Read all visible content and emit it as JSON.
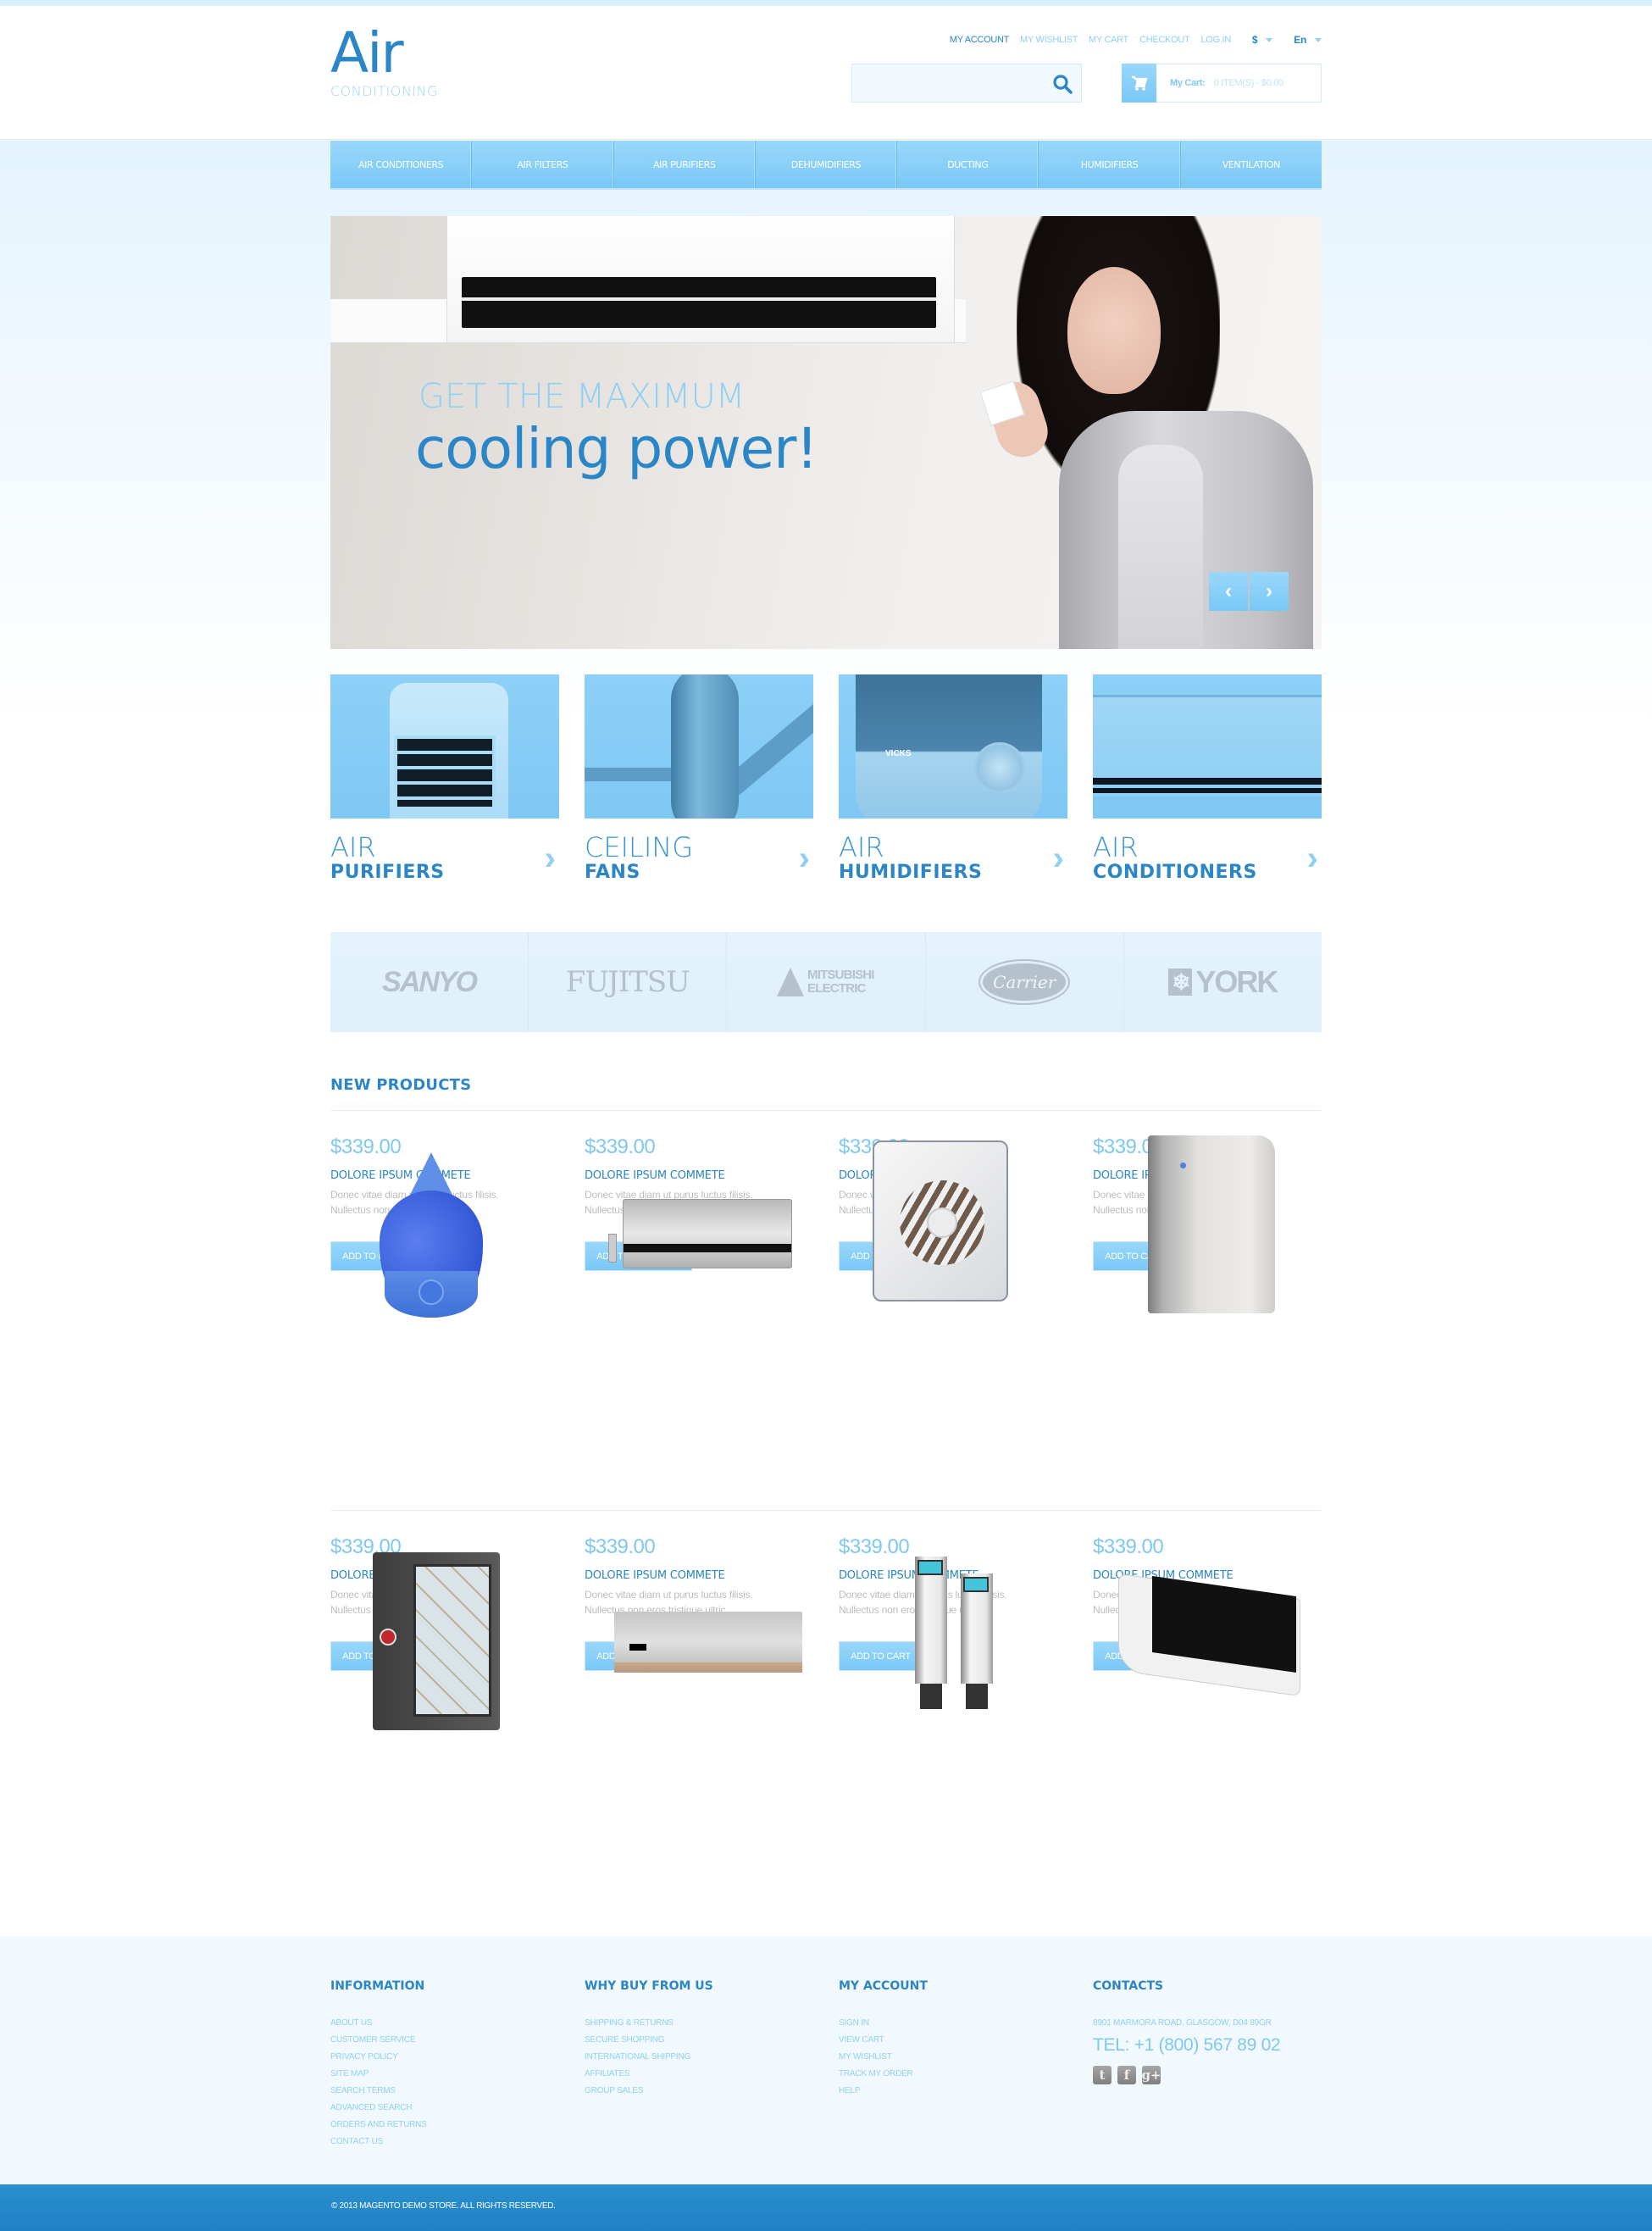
{
  "logo": {
    "main": "Air",
    "sub": "CONDITIONING"
  },
  "top_links": [
    {
      "label": "MY ACCOUNT",
      "active": true
    },
    {
      "label": "MY WISHLIST",
      "active": false
    },
    {
      "label": "MY CART",
      "active": false
    },
    {
      "label": "CHECKOUT",
      "active": false
    },
    {
      "label": "LOG IN",
      "active": false
    }
  ],
  "currency": {
    "selected": "$"
  },
  "language": {
    "selected": "En"
  },
  "search": {
    "placeholder": "",
    "value": ""
  },
  "cart": {
    "label": "My Cart:",
    "summary": "0 ITEM(S) - $0.00"
  },
  "nav": [
    "AIR CONDITIONERS",
    "AIR FILTERS",
    "AIR PURIFIERS",
    "DEHUMIDIFIERS",
    "DUCTING",
    "HUMIDIFIERS",
    "VENTILATION"
  ],
  "hero": {
    "line1": "GET THE MAXIMUM",
    "line2": "cooling power!",
    "prev_icon": "chevron-left-icon",
    "next_icon": "chevron-right-icon"
  },
  "categories": [
    {
      "line1": "AIR",
      "line2": "PURIFIERS"
    },
    {
      "line1": "CEILING",
      "line2": "FANS"
    },
    {
      "line1": "AIR",
      "line2": "HUMIDIFIERS"
    },
    {
      "line1": "AIR",
      "line2": "CONDITIONERS"
    }
  ],
  "brands": [
    "SANYO",
    "FUJITSU",
    "MITSUBISHI ELECTRIC",
    "Carrier",
    "YORK"
  ],
  "new_products": {
    "title": "NEW PRODUCTS",
    "add_to_cart": "ADD TO CART",
    "items": [
      {
        "price": "$339.00",
        "name": "DOLORE IPSUM COMMETE",
        "desc1": "Donec vitae diam ut purus luctus filisis.",
        "desc2": "Nullectus non eros tristique ultric.",
        "image": "drop-humidifier"
      },
      {
        "price": "$339.00",
        "name": "DOLORE IPSUM COMMETE",
        "desc1": "Donec vitae diam ut purus luctus filisis.",
        "desc2": "Nullectus non eros tristique ultric.",
        "image": "split-air-conditioner"
      },
      {
        "price": "$339.00",
        "name": "DOLORE IPSUM COMMETE",
        "desc1": "Donec vitae diam ut purus luctus filisis.",
        "desc2": "Nullectus non eros tristique ultric.",
        "image": "ventilation-fan"
      },
      {
        "price": "$339.00",
        "name": "DOLORE IPSUM COMMETE",
        "desc1": "Donec vitae diam ut purus luctus filisis.",
        "desc2": "Nullectus non eros tristique ultric.",
        "image": "air-purifier"
      },
      {
        "price": "$339.00",
        "name": "DOLORE IPSUM COMMETE",
        "desc1": "Donec vitae diam ut purus luctus filisis.",
        "desc2": "Nullectus non eros tristique ultric.",
        "image": "air-filter"
      },
      {
        "price": "$339.00",
        "name": "DOLORE IPSUM COMMETE",
        "desc1": "Donec vitae diam ut purus luctus filisis.",
        "desc2": "Nullectus non eros tristique ultric.",
        "image": "decorated-split-ac"
      },
      {
        "price": "$339.00",
        "name": "DOLORE IPSUM COMMETE",
        "desc1": "Donec vitae diam ut purus luctus filisis.",
        "desc2": "Nullectus non eros tristique ultric.",
        "image": "tower-purifiers"
      },
      {
        "price": "$339.00",
        "name": "DOLORE IPSUM COMMETE",
        "desc1": "Donec vitae diam ut purus luctus filisis.",
        "desc2": "Nullectus non eros tristique ultric.",
        "image": "wall-air-conditioner"
      }
    ]
  },
  "footer": {
    "information": {
      "title": "INFORMATION",
      "links": [
        "ABOUT US",
        "CUSTOMER SERVICE",
        "PRIVACY POLICY",
        "SITE MAP",
        "SEARCH TERMS",
        "ADVANCED SEARCH",
        "ORDERS AND RETURNS",
        "CONTACT US"
      ]
    },
    "why_buy": {
      "title": "WHY BUY FROM US",
      "links": [
        "SHIPPING & RETURNS",
        "SECURE SHOPPING",
        "INTERNATIONAL SHIPPING",
        "AFFILIATES",
        "GROUP SALES"
      ]
    },
    "my_account": {
      "title": "MY ACCOUNT",
      "links": [
        "SIGN IN",
        "VIEW CART",
        "MY WISHLIST",
        "TRACK MY ORDER",
        "HELP"
      ]
    },
    "contacts": {
      "title": "CONTACTS",
      "address": "8901 MARMORA ROAD, GLASGOW, D04 89GR",
      "tel": "TEL: +1 (800) 567 89 02",
      "social": [
        {
          "name": "twitter",
          "glyph": "t"
        },
        {
          "name": "facebook",
          "glyph": "f"
        },
        {
          "name": "google-plus",
          "glyph": "g+"
        }
      ]
    },
    "copyright": "© 2013 MAGENTO DEMO STORE. ALL RIGHTS RESERVED."
  },
  "colors": {
    "brand_blue": "#2a86c6",
    "light_blue": "#8fd0f3",
    "button_blue": "#7ac9f7",
    "footer_bar": "#2080c4"
  }
}
